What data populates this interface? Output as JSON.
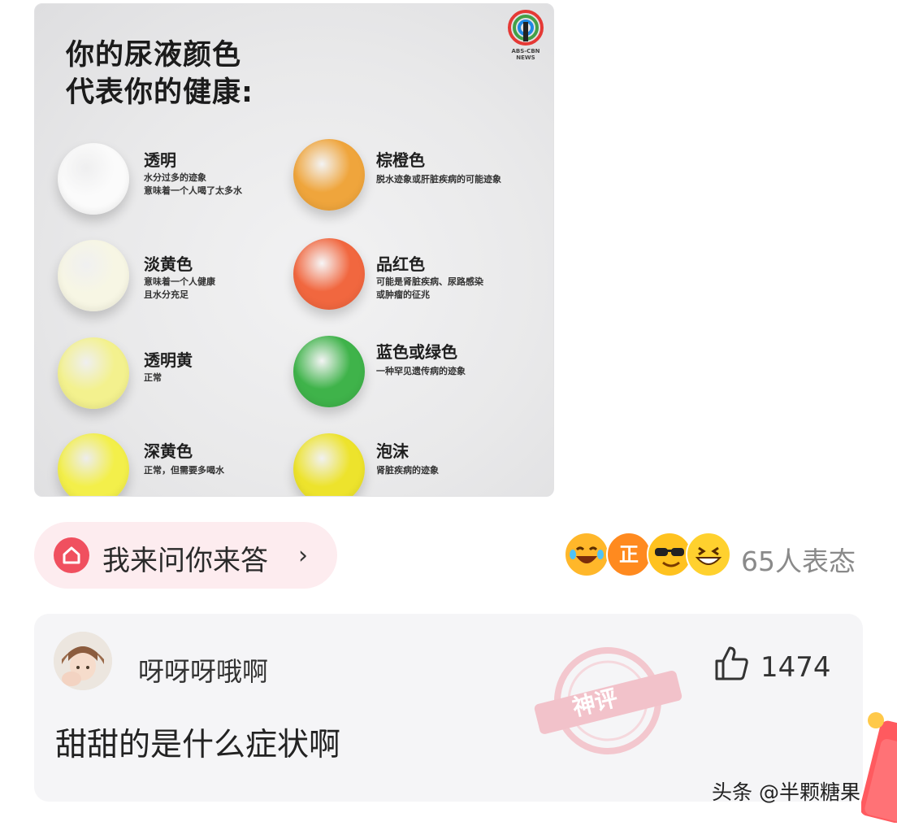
{
  "infographic": {
    "title_lines": [
      "你的尿液颜色",
      "代表你的健康:"
    ],
    "logo_text": "ABS-CBN NEWS",
    "items": [
      {
        "label": "透明",
        "desc": [
          "水分过多的迹象",
          "意味着一个人喝了太多水"
        ],
        "color": "#fbfbfb"
      },
      {
        "label": "淡黄色",
        "desc": [
          "意味着一个人健康",
          "且水分充足"
        ],
        "color": "#f7f6e4"
      },
      {
        "label": "透明黄",
        "desc": [
          "正常"
        ],
        "color": "#f3f18e"
      },
      {
        "label": "深黄色",
        "desc": [
          "正常，但需要多喝水"
        ],
        "color": "#f3ef4a"
      },
      {
        "label": "棕橙色",
        "desc": [
          "脱水迹象或肝脏疾病的可能迹象"
        ],
        "color": "#efa53c"
      },
      {
        "label": "品红色",
        "desc": [
          "可能是肾脏疾病、尿路感染",
          "或肿瘤的征兆"
        ],
        "color": "#f1673f"
      },
      {
        "label": "蓝色或绿色",
        "desc": [
          "一种罕见遗传病的迹象"
        ],
        "color": "#3fb34a"
      },
      {
        "label": "泡沫",
        "desc": [
          "肾脏疾病的迹象"
        ],
        "color": "#ede32c"
      }
    ]
  },
  "ask": {
    "label": "我来问你来答",
    "chevron": "›"
  },
  "reactions": {
    "count_text": "65人表态",
    "icons": [
      "laugh-cry-emoji",
      "zheng-badge-emoji",
      "sunglasses-emoji",
      "grin-emoji"
    ],
    "zheng_text": "正"
  },
  "comment": {
    "user_name": "呀呀呀哦啊",
    "like_count": "1474",
    "text": "甜甜的是什么症状啊",
    "stamp_text": "神评"
  },
  "watermark": "头条 @半颗糖果",
  "colors": {
    "accent_pink": "#f0505f",
    "pill_bg": "#fdecef",
    "card_bg": "#f5f5f7"
  }
}
